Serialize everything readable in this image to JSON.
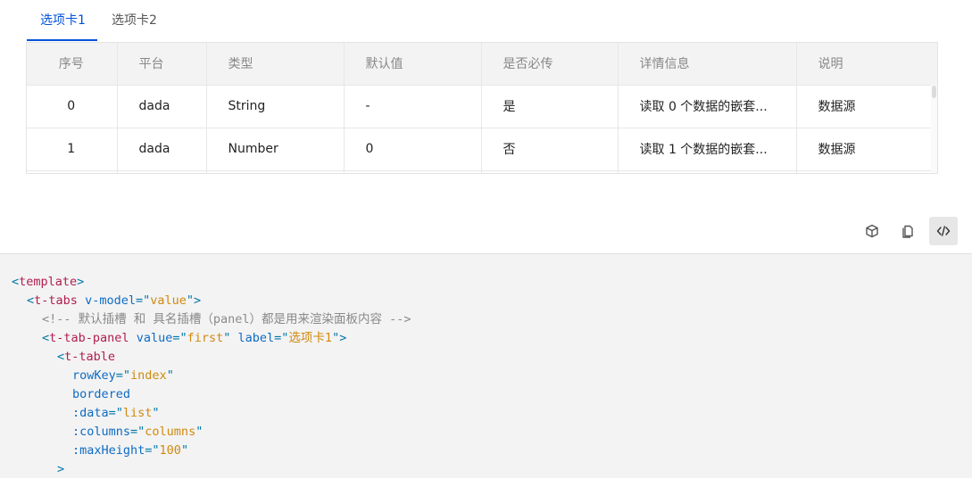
{
  "tabs": [
    {
      "label": "选项卡1",
      "active": true
    },
    {
      "label": "选项卡2",
      "active": false
    }
  ],
  "table": {
    "columns": [
      "序号",
      "平台",
      "类型",
      "默认值",
      "是否必传",
      "详情信息",
      "说明"
    ],
    "rows": [
      [
        "0",
        "dada",
        "String",
        "-",
        "是",
        "读取 0 个数据的嵌套...",
        "数据源"
      ],
      [
        "1",
        "dada",
        "Number",
        "0",
        "否",
        "读取 1 个数据的嵌套...",
        "数据源"
      ]
    ]
  },
  "toolbar": {
    "icons": [
      "cube-icon",
      "copy-icon",
      "code-icon"
    ],
    "active": "code-icon"
  },
  "code": {
    "l1_tag": "template",
    "l2_tag": "t-tabs",
    "l2_attr": "v-model",
    "l2_val": "value",
    "l3_comment": "<!-- 默认插槽 和 具名插槽（panel）都是用来渲染面板内容 -->",
    "l4_tag": "t-tab-panel",
    "l4_attr1": "value",
    "l4_val1": "first",
    "l4_attr2": "label",
    "l4_val2": "选项卡1",
    "l5_tag": "t-table",
    "l6_attr": "rowKey",
    "l6_val": "index",
    "l7_attr": "bordered",
    "l8_attr": ":data",
    "l8_val": "list",
    "l9_attr": ":columns",
    "l9_val": "columns",
    "l10_attr": ":maxHeight",
    "l10_val": "100",
    "l11": ">"
  },
  "colors": {
    "accent": "#0052d9",
    "tag": "#b11e4e",
    "attr": "#0e6bc4",
    "string": "#d08a0e",
    "comment": "#8a8a8a"
  }
}
